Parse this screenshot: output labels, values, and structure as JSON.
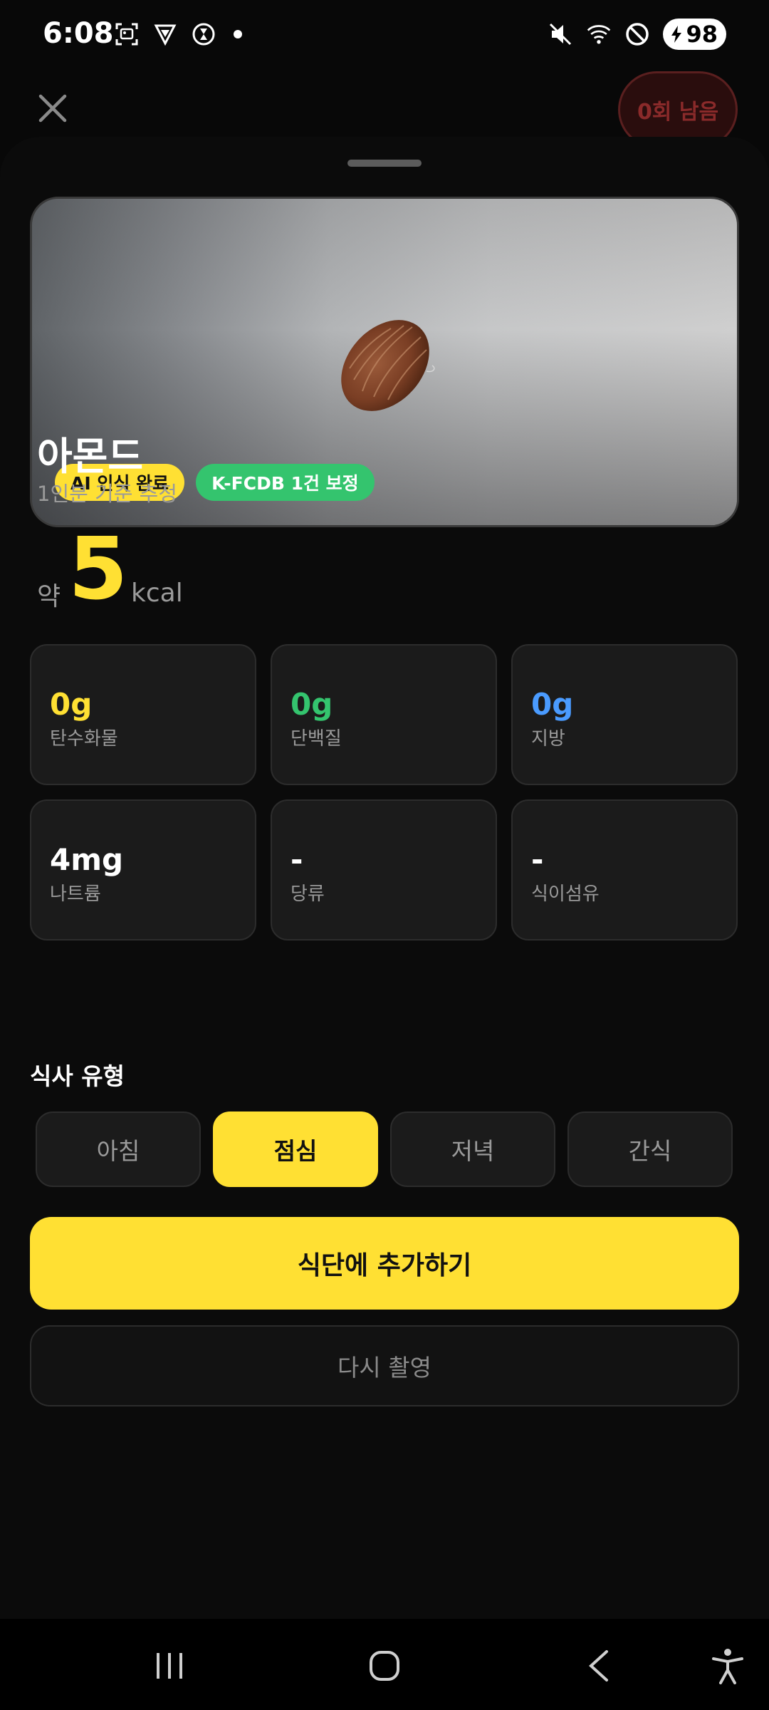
{
  "status_bar": {
    "time": "6:08",
    "battery": "98",
    "left_icons": [
      "screenshot-icon",
      "vpn-shield-icon",
      "timer-icon"
    ],
    "right_icons": [
      "mute-icon",
      "wifi-icon",
      "do-not-disturb-icon",
      "battery-icon"
    ]
  },
  "header": {
    "close_icon": "close-icon",
    "remaining_label": "0회 남음"
  },
  "photo": {
    "badges": [
      {
        "label": "AI 인식 완료",
        "color": "#ffe033"
      },
      {
        "label": "K-FCDB 1건 보정",
        "color": "#34c46e"
      }
    ]
  },
  "food": {
    "name": "아몬드",
    "subtitle": "1인분 기준 추정",
    "kcal_prefix": "약",
    "kcal_value": "5",
    "kcal_unit": "kcal"
  },
  "nutrients": [
    {
      "value": "0g",
      "label": "탄수화물",
      "color": "#ffe033"
    },
    {
      "value": "0g",
      "label": "단백질",
      "color": "#34c46e"
    },
    {
      "value": "0g",
      "label": "지방",
      "color": "#4a9bff"
    },
    {
      "value": "4mg",
      "label": "나트륨",
      "color": "#ffffff"
    },
    {
      "value": "-",
      "label": "당류",
      "color": "#ffffff"
    },
    {
      "value": "-",
      "label": "식이섬유",
      "color": "#ffffff"
    }
  ],
  "meal_type": {
    "title": "식사 유형",
    "options": [
      "아침",
      "점심",
      "저녁",
      "간식"
    ],
    "selected": "점심"
  },
  "actions": {
    "primary": "식단에 추가하기",
    "secondary": "다시 촬영"
  },
  "nav_bar": {
    "icons": [
      "recent-apps-icon",
      "home-icon",
      "back-icon",
      "accessibility-icon"
    ]
  },
  "colors": {
    "accent": "#ffe033",
    "success": "#34c46e",
    "info": "#4a9bff",
    "background": "#0b0b0b",
    "card": "#1b1b1b"
  }
}
